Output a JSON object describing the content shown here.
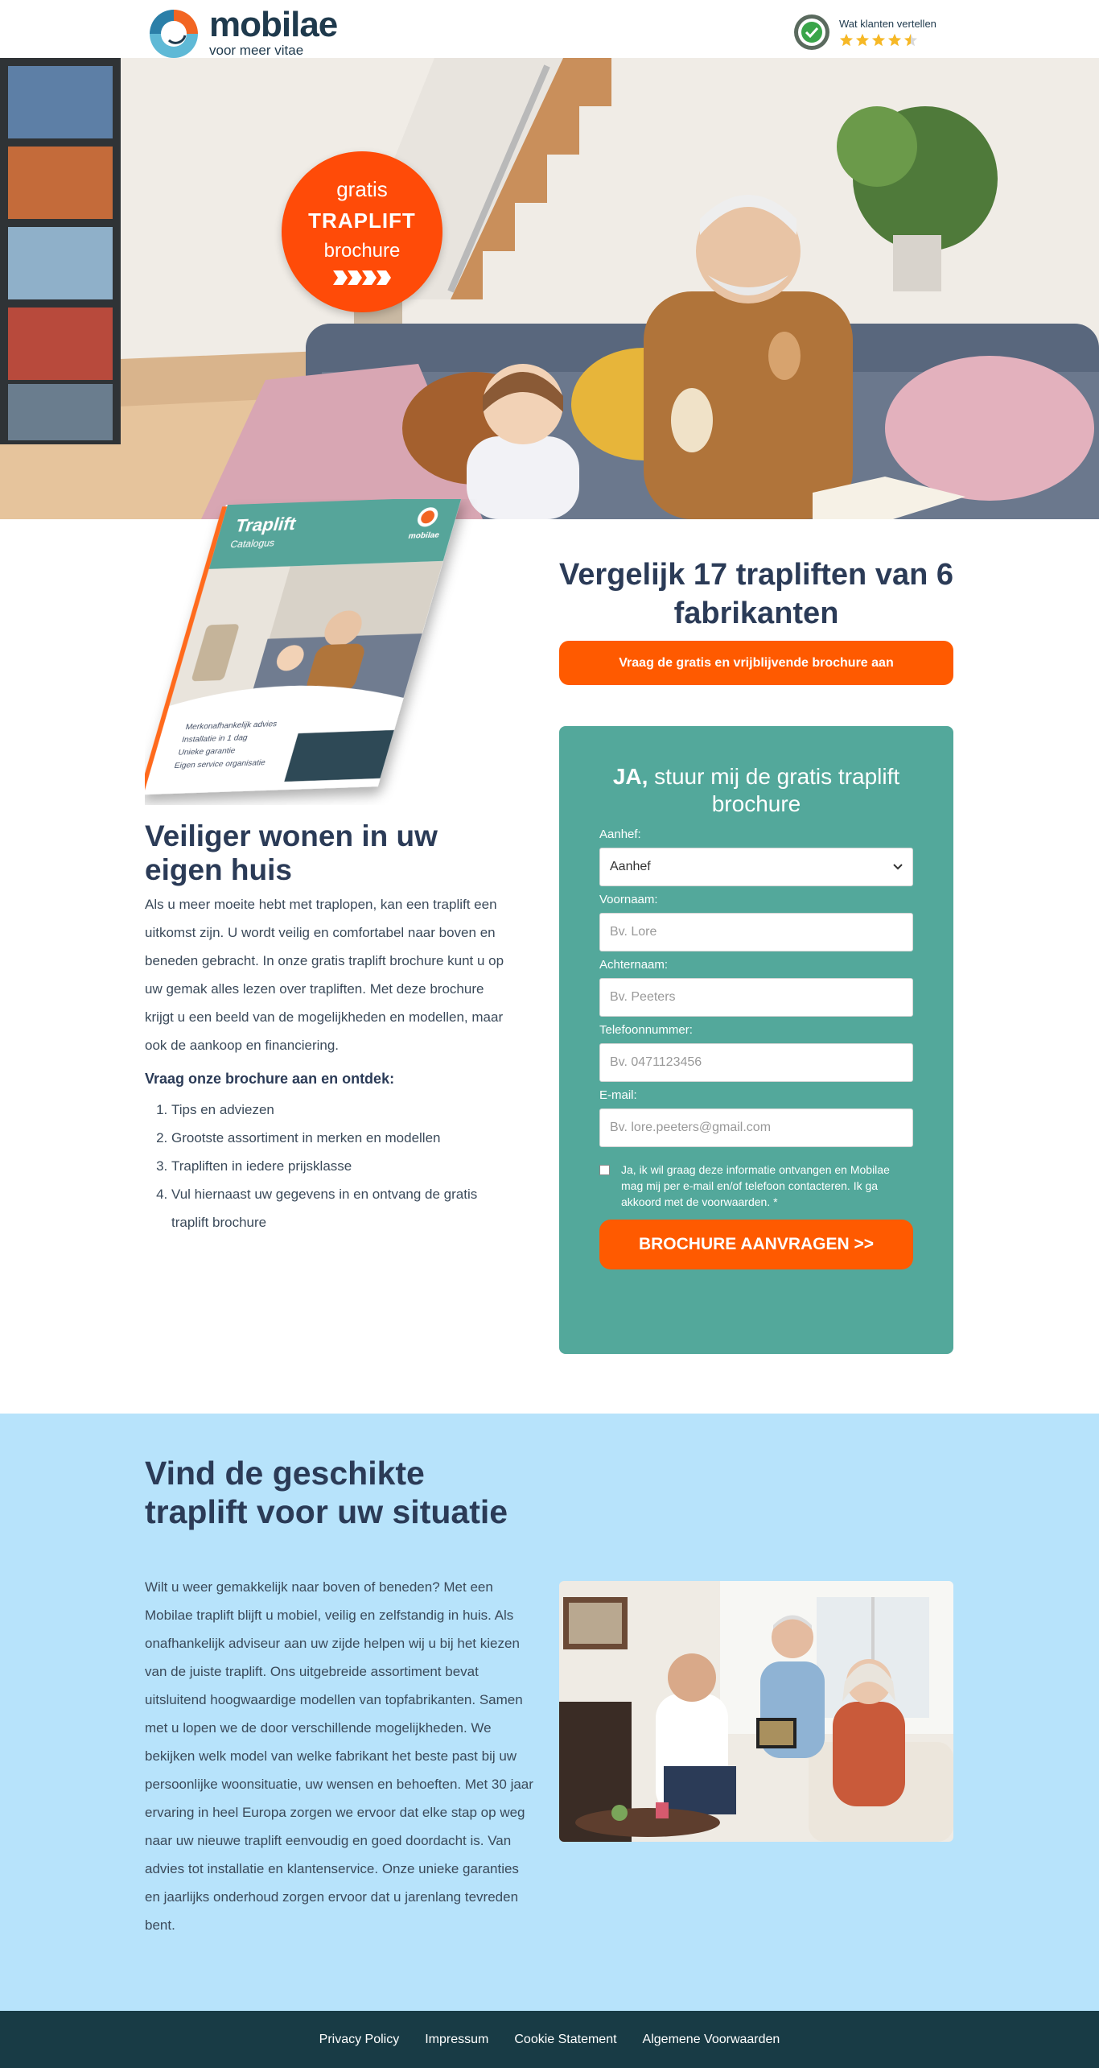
{
  "header": {
    "brand_name": "mobilae",
    "tagline": "voor meer vitae",
    "reviews_label": "Wat klanten vertellen",
    "rating": 4.5,
    "colors": {
      "brand": "#1f3a4d",
      "accent": "#ff5a00",
      "star": "#f6b826"
    }
  },
  "hero": {
    "badge_line1": "gratis",
    "badge_line2": "TRAPLIFT",
    "badge_line3": "brochure",
    "badge_color": "#ff4b08"
  },
  "brochure": {
    "title": "Traplift",
    "subtitle": "Catalogus",
    "brand": "mobilae",
    "checks": [
      "Merkonafhankelijk advies",
      "Installatie in 1 dag",
      "Unieke garantie",
      "Eigen service organisatie"
    ]
  },
  "intro": {
    "heading": "Veiliger wonen in uw eigen huis",
    "paragraph": "Als u meer moeite hebt met traplopen, kan een traplift een uitkomst zijn. U wordt veilig en comfortabel naar boven en beneden gebracht. In onze gratis traplift brochure kunt u op uw gemak alles lezen over trapliften. Met deze brochure krijgt u een beeld van de mogelijkheden en modellen, maar ook de aankoop en financiering.",
    "subheading": "Vraag onze brochure aan en ontdek:",
    "benefits": [
      "Tips en adviezen",
      "Grootste assortiment in merken en modellen",
      "Trapliften in iedere prijsklasse",
      "Vul hiernaast uw gegevens in en ontvang de gratis traplift brochure"
    ]
  },
  "compare": {
    "heading": "Vergelijk 17 trapliften van 6 fabrikanten",
    "cta": "Vraag de gratis en vrijblijvende brochure aan"
  },
  "form": {
    "title_bold": "JA,",
    "title_rest": " stuur mij de gratis traplift brochure",
    "salutation_label": "Aanhef:",
    "salutation_value": "Aanhef",
    "firstname_label": "Voornaam:",
    "firstname_placeholder": "Bv. Lore",
    "lastname_label": "Achternaam:",
    "lastname_placeholder": "Bv. Peeters",
    "phone_label": "Telefoonnummer:",
    "phone_placeholder": "Bv. 0471123456",
    "email_label": "E-mail:",
    "email_placeholder": "Bv. lore.peeters@gmail.com",
    "consent": "Ja, ik wil graag deze informatie ontvangen en Mobilae mag mij per e-mail en/of telefoon contacteren. Ik ga akkoord met de voorwaarden. *",
    "submit": "BROCHURE AANVRAGEN >>",
    "card_color": "#53a89b"
  },
  "situation": {
    "heading": "Vind de geschikte traplift voor uw situatie",
    "paragraph": "Wilt u weer gemakkelijk naar boven of beneden? Met een Mobilae traplift blijft u mobiel, veilig en zelfstandig in huis. Als onafhankelijk adviseur aan uw zijde helpen wij u bij het kiezen van de juiste traplift. Ons uitgebreide assortiment bevat uitsluitend hoogwaardige modellen van topfabrikanten. Samen met u lopen we de door verschillende mogelijkheden. We bekijken welk model van welke fabrikant het beste past bij uw persoonlijke woonsituatie, uw wensen en behoeften. Met 30 jaar ervaring in heel Europa zorgen we ervoor dat elke stap op weg naar uw nieuwe traplift eenvoudig en goed doordacht is. Van advies tot installatie en klantenservice. Onze unieke garanties en jaarlijks onderhoud zorgen ervoor dat u jarenlang tevreden bent.",
    "bg_color": "#b7e3fb"
  },
  "footer": {
    "links": [
      "Privacy Policy",
      "Impressum",
      "Cookie Statement",
      "Algemene Voorwaarden"
    ],
    "bg_color": "#183b45"
  }
}
